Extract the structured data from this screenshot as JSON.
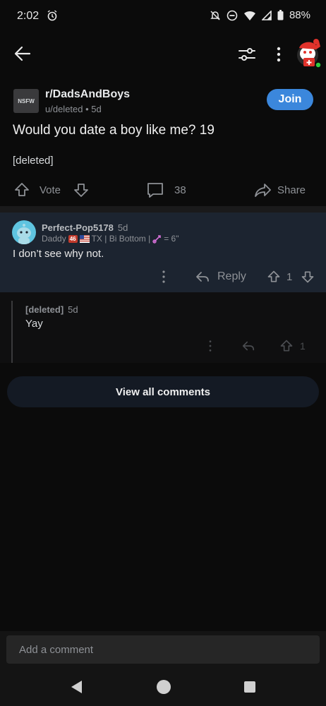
{
  "status_bar": {
    "time": "2:02",
    "battery": "88%"
  },
  "post": {
    "nsfw_label": "NSFW",
    "subreddit": "r/DadsAndBoys",
    "author": "u/deleted",
    "age": "5d",
    "join_label": "Join",
    "title": "Would you date a boy like me? 19",
    "body": "[deleted]",
    "vote_label": "Vote",
    "comment_count": "38",
    "share_label": "Share"
  },
  "comments": [
    {
      "username": "Perfect-Pop5178",
      "age": "5d",
      "flair_pre": "Daddy",
      "flair_badge": "46",
      "flair_mid": "TX | Bi Bottom |",
      "flair_post": "= 6\"",
      "text": "I don’t see why not.",
      "reply_label": "Reply",
      "score": "1"
    },
    {
      "username": "[deleted]",
      "age": "5d",
      "text": "Yay",
      "score": "1"
    }
  ],
  "view_all_label": "View all comments",
  "add_comment_placeholder": "Add a comment",
  "colors": {
    "join": "#3b87dc",
    "highlight_comment_bg": "#1c2430"
  }
}
